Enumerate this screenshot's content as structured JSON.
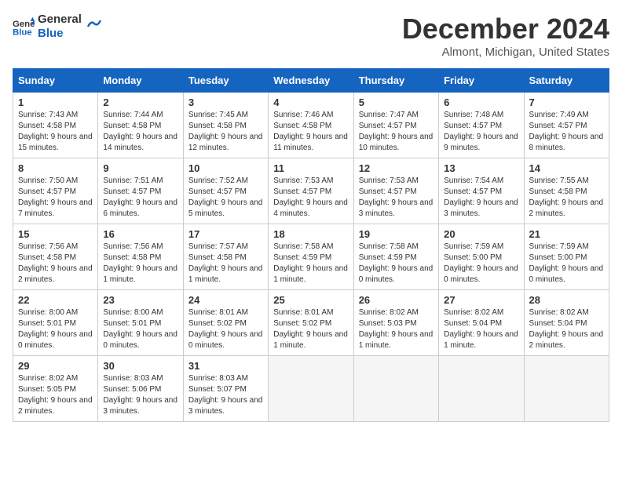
{
  "logo": {
    "line1": "General",
    "line2": "Blue"
  },
  "title": "December 2024",
  "subtitle": "Almont, Michigan, United States",
  "days_of_week": [
    "Sunday",
    "Monday",
    "Tuesday",
    "Wednesday",
    "Thursday",
    "Friday",
    "Saturday"
  ],
  "weeks": [
    [
      {
        "num": "1",
        "sunrise": "7:43 AM",
        "sunset": "4:58 PM",
        "daylight": "9 hours and 15 minutes."
      },
      {
        "num": "2",
        "sunrise": "7:44 AM",
        "sunset": "4:58 PM",
        "daylight": "9 hours and 14 minutes."
      },
      {
        "num": "3",
        "sunrise": "7:45 AM",
        "sunset": "4:58 PM",
        "daylight": "9 hours and 12 minutes."
      },
      {
        "num": "4",
        "sunrise": "7:46 AM",
        "sunset": "4:58 PM",
        "daylight": "9 hours and 11 minutes."
      },
      {
        "num": "5",
        "sunrise": "7:47 AM",
        "sunset": "4:57 PM",
        "daylight": "9 hours and 10 minutes."
      },
      {
        "num": "6",
        "sunrise": "7:48 AM",
        "sunset": "4:57 PM",
        "daylight": "9 hours and 9 minutes."
      },
      {
        "num": "7",
        "sunrise": "7:49 AM",
        "sunset": "4:57 PM",
        "daylight": "9 hours and 8 minutes."
      }
    ],
    [
      {
        "num": "8",
        "sunrise": "7:50 AM",
        "sunset": "4:57 PM",
        "daylight": "9 hours and 7 minutes."
      },
      {
        "num": "9",
        "sunrise": "7:51 AM",
        "sunset": "4:57 PM",
        "daylight": "9 hours and 6 minutes."
      },
      {
        "num": "10",
        "sunrise": "7:52 AM",
        "sunset": "4:57 PM",
        "daylight": "9 hours and 5 minutes."
      },
      {
        "num": "11",
        "sunrise": "7:53 AM",
        "sunset": "4:57 PM",
        "daylight": "9 hours and 4 minutes."
      },
      {
        "num": "12",
        "sunrise": "7:53 AM",
        "sunset": "4:57 PM",
        "daylight": "9 hours and 3 minutes."
      },
      {
        "num": "13",
        "sunrise": "7:54 AM",
        "sunset": "4:57 PM",
        "daylight": "9 hours and 3 minutes."
      },
      {
        "num": "14",
        "sunrise": "7:55 AM",
        "sunset": "4:58 PM",
        "daylight": "9 hours and 2 minutes."
      }
    ],
    [
      {
        "num": "15",
        "sunrise": "7:56 AM",
        "sunset": "4:58 PM",
        "daylight": "9 hours and 2 minutes."
      },
      {
        "num": "16",
        "sunrise": "7:56 AM",
        "sunset": "4:58 PM",
        "daylight": "9 hours and 1 minute."
      },
      {
        "num": "17",
        "sunrise": "7:57 AM",
        "sunset": "4:58 PM",
        "daylight": "9 hours and 1 minute."
      },
      {
        "num": "18",
        "sunrise": "7:58 AM",
        "sunset": "4:59 PM",
        "daylight": "9 hours and 1 minute."
      },
      {
        "num": "19",
        "sunrise": "7:58 AM",
        "sunset": "4:59 PM",
        "daylight": "9 hours and 0 minutes."
      },
      {
        "num": "20",
        "sunrise": "7:59 AM",
        "sunset": "5:00 PM",
        "daylight": "9 hours and 0 minutes."
      },
      {
        "num": "21",
        "sunrise": "7:59 AM",
        "sunset": "5:00 PM",
        "daylight": "9 hours and 0 minutes."
      }
    ],
    [
      {
        "num": "22",
        "sunrise": "8:00 AM",
        "sunset": "5:01 PM",
        "daylight": "9 hours and 0 minutes."
      },
      {
        "num": "23",
        "sunrise": "8:00 AM",
        "sunset": "5:01 PM",
        "daylight": "9 hours and 0 minutes."
      },
      {
        "num": "24",
        "sunrise": "8:01 AM",
        "sunset": "5:02 PM",
        "daylight": "9 hours and 0 minutes."
      },
      {
        "num": "25",
        "sunrise": "8:01 AM",
        "sunset": "5:02 PM",
        "daylight": "9 hours and 1 minute."
      },
      {
        "num": "26",
        "sunrise": "8:02 AM",
        "sunset": "5:03 PM",
        "daylight": "9 hours and 1 minute."
      },
      {
        "num": "27",
        "sunrise": "8:02 AM",
        "sunset": "5:04 PM",
        "daylight": "9 hours and 1 minute."
      },
      {
        "num": "28",
        "sunrise": "8:02 AM",
        "sunset": "5:04 PM",
        "daylight": "9 hours and 2 minutes."
      }
    ],
    [
      {
        "num": "29",
        "sunrise": "8:02 AM",
        "sunset": "5:05 PM",
        "daylight": "9 hours and 2 minutes."
      },
      {
        "num": "30",
        "sunrise": "8:03 AM",
        "sunset": "5:06 PM",
        "daylight": "9 hours and 3 minutes."
      },
      {
        "num": "31",
        "sunrise": "8:03 AM",
        "sunset": "5:07 PM",
        "daylight": "9 hours and 3 minutes."
      },
      null,
      null,
      null,
      null
    ]
  ]
}
